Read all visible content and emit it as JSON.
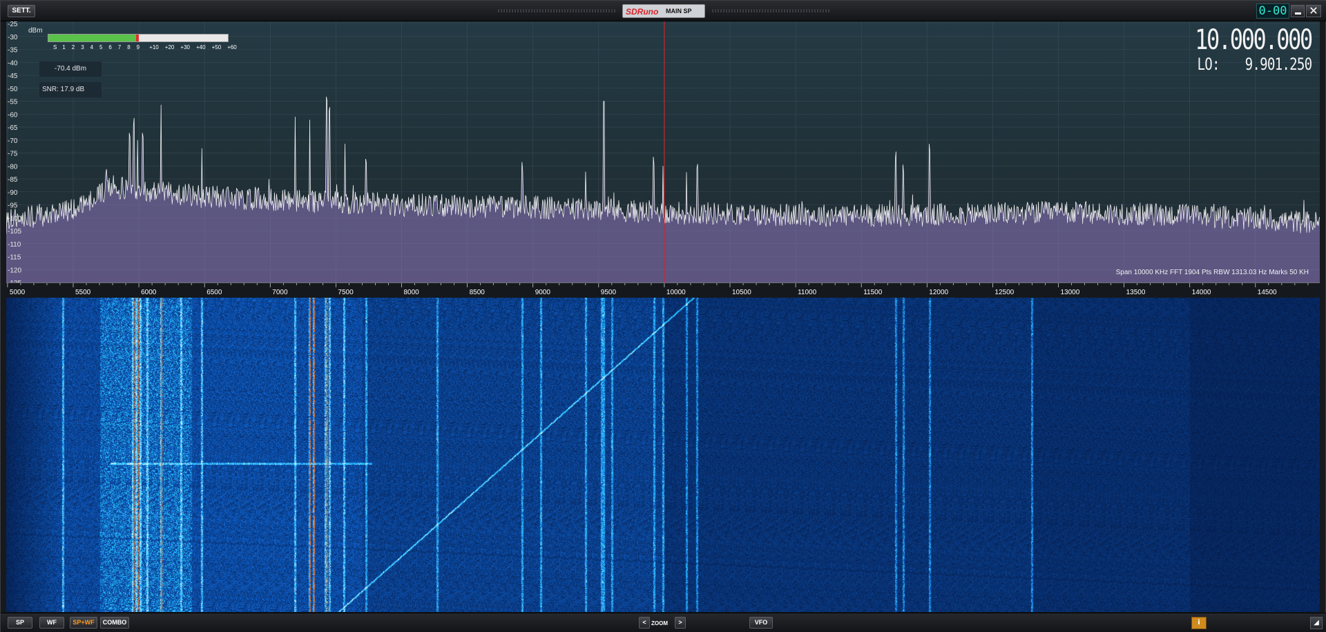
{
  "titlebar": {
    "settings_label": "SETT.",
    "logo_text": "SDRuno",
    "panel_name": "MAIN SP",
    "channel_id": "0-00",
    "minimize_icon": "minimize-icon",
    "close_icon": "close-icon"
  },
  "spectrum": {
    "unit": "dBm",
    "y_ticks": [
      "-25",
      "-30",
      "-35",
      "-40",
      "-45",
      "-50",
      "-55",
      "-60",
      "-65",
      "-70",
      "-75",
      "-80",
      "-85",
      "-90",
      "-95",
      "-100",
      "-105",
      "-110",
      "-115",
      "-120",
      "-125"
    ],
    "power_readout": "-70.4 dBm",
    "snr_readout": "SNR: 17.9 dB",
    "frequency": "10.000.000",
    "lo_label": "LO:",
    "lo_value": "9.901.250",
    "span_info": "Span 10000 KHz   FFT 1904 Pts   RBW 1313.03 Hz   Marks 50 KH",
    "smeter": {
      "scale": [
        "S",
        "1",
        "2",
        "3",
        "4",
        "5",
        "6",
        "7",
        "8",
        "9",
        "+10",
        "+20",
        "+30",
        "+40",
        "+50",
        "+60"
      ],
      "level_fraction": 0.49,
      "fill_color": "#5ac24a",
      "peak_color": "#e03030"
    },
    "tuning_line_color": "#c8282c"
  },
  "freq_axis": {
    "labels": [
      "5000",
      "5500",
      "6000",
      "6500",
      "7000",
      "7500",
      "8000",
      "8500",
      "9000",
      "9500",
      "10000",
      "10500",
      "11000",
      "11500",
      "12000",
      "12500",
      "13000",
      "13500",
      "14000",
      "14500"
    ]
  },
  "chart_data": {
    "type": "line",
    "title": "",
    "xlabel": "",
    "ylabel": "dBm",
    "xlim": [
      4990,
      14990
    ],
    "ylim": [
      -125,
      -25
    ],
    "x_ticks": [
      5000,
      5500,
      6000,
      6500,
      7000,
      7500,
      8000,
      8500,
      9000,
      9500,
      10000,
      10500,
      11000,
      11500,
      12000,
      12500,
      13000,
      13500,
      14000,
      14500
    ],
    "noise_floor": [
      {
        "x": 5000,
        "y": -101
      },
      {
        "x": 5500,
        "y": -97
      },
      {
        "x": 5800,
        "y": -88
      },
      {
        "x": 6500,
        "y": -92
      },
      {
        "x": 7000,
        "y": -93
      },
      {
        "x": 8000,
        "y": -95
      },
      {
        "x": 9000,
        "y": -96
      },
      {
        "x": 10000,
        "y": -98
      },
      {
        "x": 11000,
        "y": -99
      },
      {
        "x": 12000,
        "y": -99
      },
      {
        "x": 13000,
        "y": -98
      },
      {
        "x": 14000,
        "y": -99
      },
      {
        "x": 14990,
        "y": -102
      }
    ],
    "peaks": [
      {
        "x": 5750,
        "y": -86
      },
      {
        "x": 5930,
        "y": -72
      },
      {
        "x": 5960,
        "y": -67
      },
      {
        "x": 5990,
        "y": -70
      },
      {
        "x": 6030,
        "y": -72
      },
      {
        "x": 6170,
        "y": -58
      },
      {
        "x": 6480,
        "y": -74
      },
      {
        "x": 6990,
        "y": -85
      },
      {
        "x": 7190,
        "y": -61
      },
      {
        "x": 7300,
        "y": -63
      },
      {
        "x": 7430,
        "y": -58
      },
      {
        "x": 7450,
        "y": -62
      },
      {
        "x": 7570,
        "y": -73
      },
      {
        "x": 7730,
        "y": -82
      },
      {
        "x": 8920,
        "y": -84
      },
      {
        "x": 9400,
        "y": -83
      },
      {
        "x": 9540,
        "y": -59
      },
      {
        "x": 9920,
        "y": -82
      },
      {
        "x": 9990,
        "y": -80
      },
      {
        "x": 10170,
        "y": -84
      },
      {
        "x": 10250,
        "y": -84
      },
      {
        "x": 11760,
        "y": -80
      },
      {
        "x": 11820,
        "y": -85
      },
      {
        "x": 12020,
        "y": -77
      }
    ]
  },
  "waterfall": {
    "carriers_khz": [
      5420,
      5950,
      5980,
      6010,
      6060,
      6170,
      6320,
      6480,
      7190,
      7300,
      7330,
      7420,
      7450,
      7560,
      7730,
      8270,
      8920,
      9060,
      9400,
      9520,
      9540,
      9600,
      9920,
      9990,
      10170,
      10250,
      11760,
      11820,
      12020,
      12800
    ]
  },
  "bottombar": {
    "sp": "SP",
    "wf": "WF",
    "spwf": "SP+WF",
    "combo": "COMBO",
    "zoom_prev": "<",
    "zoom_label": "ZOOM",
    "zoom_next": ">",
    "vfo": "VFO",
    "info": "i",
    "resize_icon": "resize-corner-icon"
  }
}
